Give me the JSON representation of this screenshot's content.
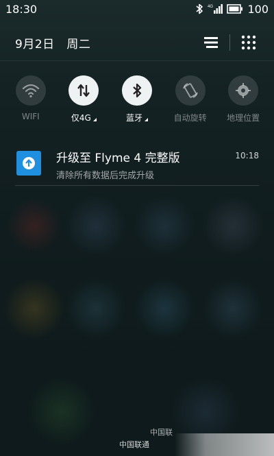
{
  "status_bar": {
    "time": "18:30",
    "network": "4G",
    "battery": "100"
  },
  "header": {
    "date": "9月2日",
    "weekday": "周二"
  },
  "quick_toggles": [
    {
      "label": "WIFI",
      "icon": "wifi-icon",
      "state": "off"
    },
    {
      "label": "仅4G",
      "icon": "mobile-data-icon",
      "state": "on"
    },
    {
      "label": "蓝牙",
      "icon": "bluetooth-icon",
      "state": "on"
    },
    {
      "label": "自动旋转",
      "icon": "auto-rotate-icon",
      "state": "off"
    },
    {
      "label": "地理位置",
      "icon": "location-icon",
      "state": "off"
    }
  ],
  "notification": {
    "title": "升级至 Flyme 4 完整版",
    "subtitle": "清除所有数据后完成升级",
    "time": "10:18",
    "icon": "upgrade-icon",
    "icon_color": "#1f8fe0"
  },
  "carrier": {
    "line1": "中国联",
    "line2": "中国联通"
  }
}
